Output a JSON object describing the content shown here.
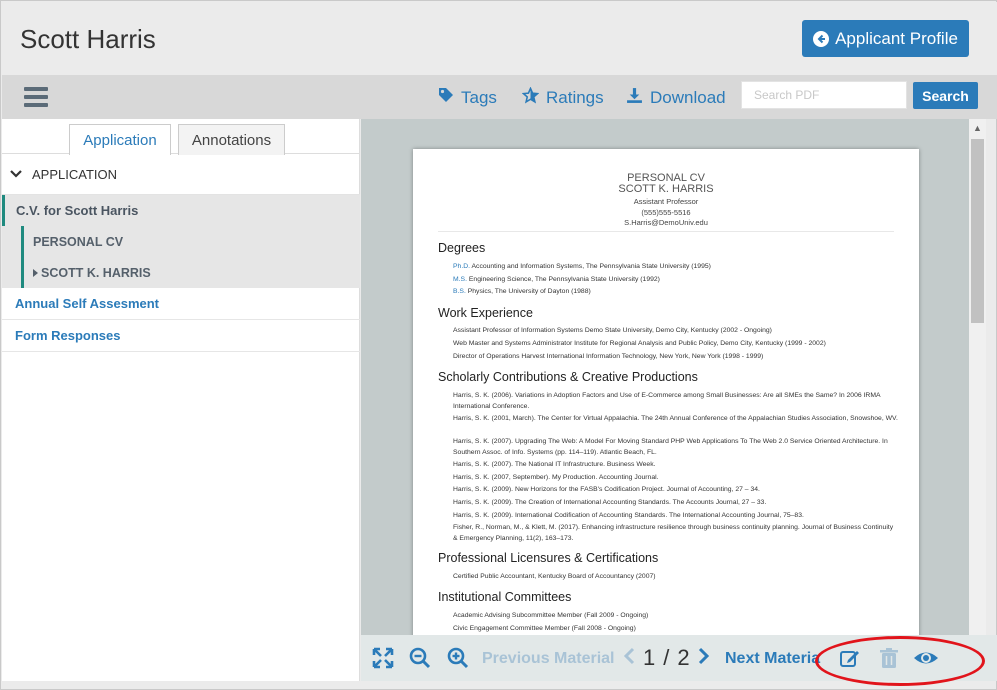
{
  "header": {
    "applicant_name": "Scott Harris",
    "profile_button": "Applicant Profile"
  },
  "toolbar": {
    "tags": "Tags",
    "ratings": "Ratings",
    "download": "Download",
    "search_placeholder": "Search PDF",
    "search_button": "Search"
  },
  "sidebar": {
    "tabs": [
      "Application",
      "Annotations"
    ],
    "section": "APPLICATION",
    "cv_item": "C.V. for Scott Harris",
    "sub_items": [
      "PERSONAL CV",
      "SCOTT K. HARRIS"
    ],
    "links": [
      "Annual Self Assesment",
      "Form Responses"
    ]
  },
  "document": {
    "header": {
      "title": "PERSONAL CV",
      "name": "SCOTT K. HARRIS",
      "position": "Assistant Professor",
      "phone": "(555)555-5516",
      "email": "S.Harris@DemoUniv.edu"
    },
    "sections": {
      "degrees": "Degrees",
      "work": "Work Experience",
      "scholarly": "Scholarly Contributions & Creative Productions",
      "licensures": "Professional Licensures & Certifications",
      "committees": "Institutional Committees"
    },
    "degrees": [
      {
        "deg": "Ph.D.",
        "text": "Accounting and Information Systems, The Pennsylvania State University (1995)"
      },
      {
        "deg": "M.S.",
        "text": "Engineering Science, The Pennsylvania State University (1992)"
      },
      {
        "deg": "B.S.",
        "text": "Physics, The University of Dayton (1988)"
      }
    ],
    "work": [
      "Assistant Professor of Information Systems Demo State University, Demo City, Kentucky (2002 - Ongoing)",
      "Web Master and Systems Administrator Institute for Regional Analysis and Public Policy, Demo City, Kentucky (1999 - 2002)",
      "Director of Operations Harvest International Information Technology, New York, New York (1998 - 1999)"
    ],
    "scholarly": [
      "Harris, S. K. (2006). Variations in Adoption Factors and Use of E-Commerce among Small Businesses: Are all SMEs the Same? In 2006 IRMA International Conference.",
      "Harris, S. K. (2001, March). The Center for Virtual Appalachia. The 24th Annual Conference of the Appalachian Studies Association, Snowshoe, WV.",
      "Harris, S. K. (2007). Upgrading The Web: A Model For Moving Standard PHP Web Applications To The Web 2.0 Service Oriented Architecture. In Southern Assoc. of Info. Systems (pp. 114–119). Atlantic Beach, FL.",
      "Harris, S. K. (2007). The National IT Infrastructure. Business Week.",
      "Harris, S. K. (2007, September). My Production. Accounting Journal.",
      "Harris, S. K. (2009). New Horizons for the FASB's Codification Project. Journal of Accounting, 27 – 34.",
      "Harris, S. K. (2009). The Creation of International Accounting Standards. The Accounts Journal, 27 – 33.",
      "Harris, S. K. (2009). International Codification of Accounting Standards. The International Accounting Journal, 75–83.",
      "Fisher, R., Norman, M., & Klett, M. (2017). Enhancing infrastructure resilience through business continuity planning. Journal of Business Continuity & Emergency Planning, 11(2), 163–173."
    ],
    "licensures": [
      "Certified Public Accountant, Kentucky Board of Accountancy (2007)"
    ],
    "committees": [
      "Academic Advising Subcommittee Member (Fall 2009 - Ongoing)",
      "Civic Engagement Committee Member (Fall 2008 - Ongoing)"
    ]
  },
  "bottombar": {
    "previous": "Previous Material",
    "page_current": "1",
    "page_sep": "/",
    "page_total": "2",
    "next": "Next Materia"
  },
  "colors": {
    "accent": "#2b7bb9",
    "teal": "#1f8a7f",
    "highlight_circle": "#e1141b"
  }
}
